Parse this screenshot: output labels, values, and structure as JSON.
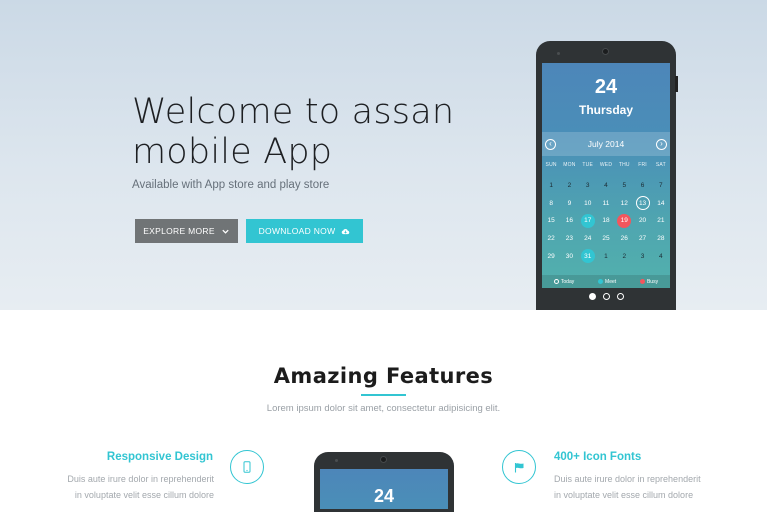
{
  "hero": {
    "title": "Welcome to assan mobile App",
    "subtitle": "Available with App store and play store",
    "explore_label": "EXPLORE MORE",
    "download_label": "DOWNLOAD NOW"
  },
  "phone": {
    "day_number": "24",
    "weekday": "Thursday",
    "month": "July 2014",
    "weekdays": [
      "SUN",
      "MON",
      "TUE",
      "WED",
      "THU",
      "FRI",
      "SAT"
    ],
    "days": [
      [
        "1",
        "2",
        "3",
        "4",
        "5",
        "6",
        "7"
      ],
      [
        "8",
        "9",
        "10",
        "11",
        "12",
        "13",
        "14"
      ],
      [
        "15",
        "16",
        "17",
        "18",
        "19",
        "20",
        "21"
      ],
      [
        "22",
        "23",
        "24",
        "25",
        "26",
        "27",
        "28"
      ],
      [
        "29",
        "30",
        "31",
        "1",
        "2",
        "3",
        "4"
      ]
    ],
    "legend": {
      "today": "Today",
      "meet": "Meet",
      "busy": "Busy"
    },
    "slides_total": 3,
    "slide_active": 1
  },
  "features": {
    "title": "Amazing Features",
    "subtitle": "Lorem ipsum dolor sit amet, consectetur adipisicing elit.",
    "left": {
      "title": "Responsive Design",
      "line1": "Duis aute irure dolor in reprehenderit",
      "line2": "in voluptate velit esse cillum dolore"
    },
    "right": {
      "title": "400+ Icon Fonts",
      "line1": "Duis aute irure dolor in reprehenderit",
      "line2": "in voluptate velit esse cillum dolore"
    },
    "phone_number": "24"
  },
  "colors": {
    "accent": "#32c5d2",
    "meet": "#32c5d2",
    "busy": "#f3565d",
    "explore_button": "#707476"
  },
  "icons": {
    "explore": "chevron-down-icon",
    "download": "cloud-download-icon",
    "responsive": "mobile-icon",
    "icon_fonts": "flag-icon",
    "prev": "chevron-left-icon",
    "next": "chevron-right-icon"
  }
}
